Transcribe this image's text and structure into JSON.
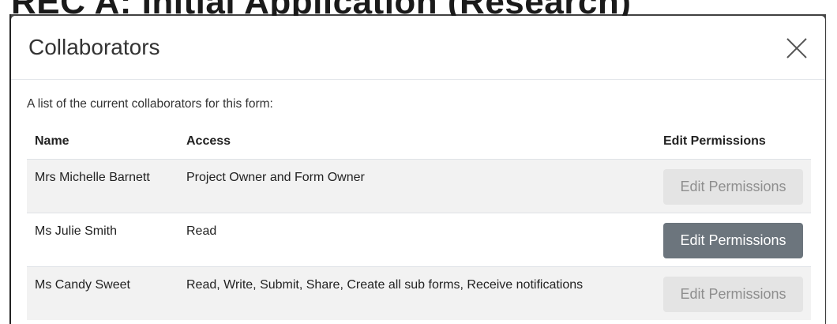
{
  "background_page": {
    "title": "REC A: Initial Application (Research)"
  },
  "modal": {
    "title": "Collaborators",
    "close_icon": "close-icon",
    "intro": "A list of the current collaborators for this form:",
    "columns": [
      "Name",
      "Access",
      "Edit Permissions"
    ],
    "rows": [
      {
        "name": "Mrs Michelle Barnett",
        "access": "Project Owner and Form Owner",
        "button_label": "Edit Permissions",
        "button_enabled": false
      },
      {
        "name": "Ms Julie Smith",
        "access": "Read",
        "button_label": "Edit Permissions",
        "button_enabled": true
      },
      {
        "name": "Ms Candy Sweet",
        "access": "Read, Write, Submit, Share, Create all sub forms, Receive notifications",
        "button_label": "Edit Permissions",
        "button_enabled": false
      }
    ]
  },
  "colors": {
    "button_active": "#6c757d",
    "button_disabled": "#e4e4e4",
    "row_stripe": "#f2f2f2"
  }
}
